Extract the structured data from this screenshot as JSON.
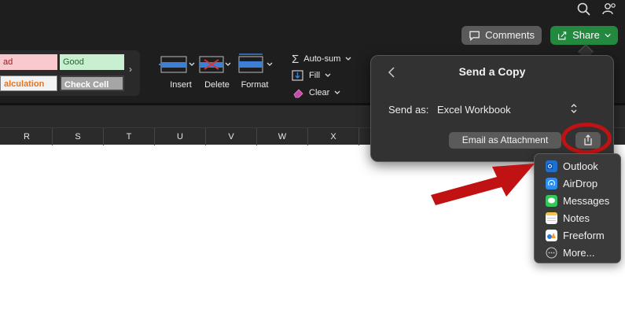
{
  "toolbar": {
    "comments_label": "Comments",
    "share_label": "Share"
  },
  "styles": {
    "bad": "ad",
    "good": "Good",
    "calculation": "alculation",
    "check_cell": "Check Cell"
  },
  "cells": {
    "insert": "Insert",
    "delete": "Delete",
    "format": "Format"
  },
  "editing": {
    "autosum": "Auto-sum",
    "fill": "Fill",
    "clear": "Clear"
  },
  "columns": [
    "R",
    "S",
    "T",
    "U",
    "V",
    "W",
    "X"
  ],
  "send_copy": {
    "title": "Send a Copy",
    "send_as_label": "Send as:",
    "send_as_value": "Excel Workbook",
    "email_button": "Email as Attachment"
  },
  "share_menu": {
    "items": [
      {
        "label": "Outlook",
        "icon": "outlook-icon",
        "color": "#1f6fd0"
      },
      {
        "label": "AirDrop",
        "icon": "airdrop-icon",
        "color": "#2d8ef0"
      },
      {
        "label": "Messages",
        "icon": "messages-icon",
        "color": "#34c759"
      },
      {
        "label": "Notes",
        "icon": "notes-icon",
        "color": "#f5c542"
      },
      {
        "label": "Freeform",
        "icon": "freeform-icon",
        "color": "#ffffff"
      },
      {
        "label": "More...",
        "icon": "more-icon",
        "color": "#3a3a3a"
      }
    ]
  },
  "colors": {
    "share_green": "#23893f",
    "annotation_red": "#c01212",
    "ribbon_bg": "#1e1e1e"
  }
}
